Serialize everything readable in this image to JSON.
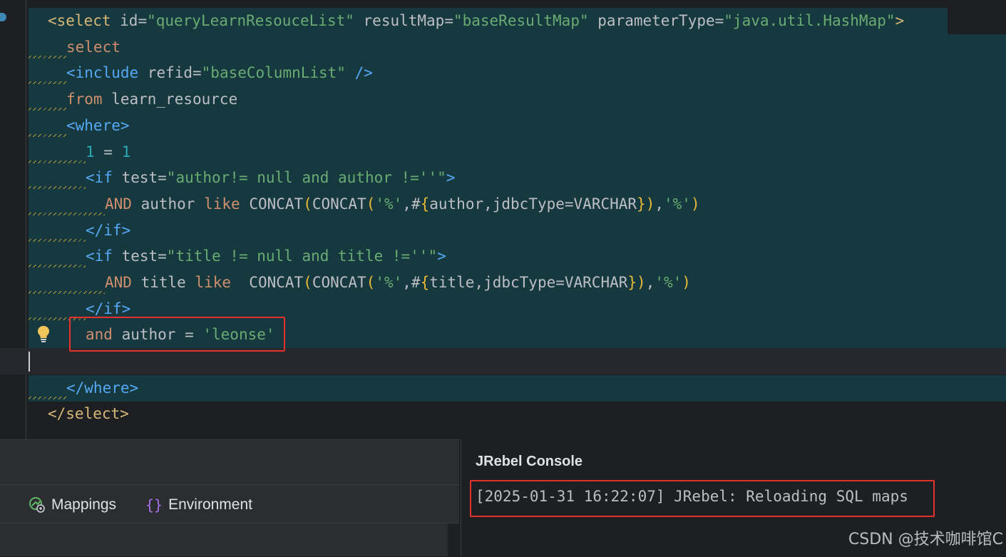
{
  "editor": {
    "lines": [
      {
        "parts": [
          [
            "tag",
            "<select "
          ],
          [
            "attr",
            "id="
          ],
          [
            "val",
            "\"queryLearnResouceList\""
          ],
          [
            "attr",
            " resultMap="
          ],
          [
            "val",
            "\"baseResultMap\""
          ],
          [
            "attr",
            " parameterType="
          ],
          [
            "val",
            "\"java.util.HashMap\""
          ],
          [
            "tag",
            ">"
          ]
        ]
      },
      {
        "parts": [
          [
            "kw",
            "select"
          ]
        ]
      },
      {
        "parts": [
          [
            "sqltag",
            "<include "
          ],
          [
            "attr",
            "refid="
          ],
          [
            "val",
            "\"baseColumnList\""
          ],
          [
            "sqltag",
            " />"
          ]
        ]
      },
      {
        "parts": [
          [
            "kw",
            "from "
          ],
          [
            "attr",
            "learn_resource"
          ]
        ]
      },
      {
        "parts": [
          [
            "sqltag",
            "<where>"
          ]
        ]
      },
      {
        "parts": [
          [
            "num",
            "1"
          ],
          [
            "attr",
            " = "
          ],
          [
            "num",
            "1"
          ]
        ]
      },
      {
        "parts": [
          [
            "sqltag",
            "<if "
          ],
          [
            "attr",
            "test="
          ],
          [
            "val",
            "\"author!= null and author !=''\""
          ],
          [
            "sqltag",
            ">"
          ]
        ]
      },
      {
        "parts": [
          [
            "kw",
            "AND "
          ],
          [
            "attr",
            "author "
          ],
          [
            "kw",
            "like "
          ],
          [
            "fn",
            "CONCAT"
          ],
          [
            "par",
            "("
          ],
          [
            "fn",
            "CONCAT"
          ],
          [
            "par",
            "("
          ],
          [
            "str",
            "'%'"
          ],
          [
            "attr",
            ","
          ],
          [
            "fn",
            "#"
          ],
          [
            "par",
            "{"
          ],
          [
            "attr",
            "author,jdbcType=VARCHAR"
          ],
          [
            "par",
            "}"
          ],
          [
            "par",
            ")"
          ],
          [
            "attr",
            ","
          ],
          [
            "str",
            "'%'"
          ],
          [
            "par",
            ")"
          ]
        ]
      },
      {
        "parts": [
          [
            "sqltag",
            "</if>"
          ]
        ]
      },
      {
        "parts": [
          [
            "sqltag",
            "<if "
          ],
          [
            "attr",
            "test="
          ],
          [
            "val",
            "\"title != null and title !=''\""
          ],
          [
            "sqltag",
            ">"
          ]
        ]
      },
      {
        "parts": [
          [
            "kw",
            "AND "
          ],
          [
            "attr",
            "title "
          ],
          [
            "kw",
            "like  "
          ],
          [
            "fn",
            "CONCAT"
          ],
          [
            "par",
            "("
          ],
          [
            "fn",
            "CONCAT"
          ],
          [
            "par",
            "("
          ],
          [
            "str",
            "'%'"
          ],
          [
            "attr",
            ","
          ],
          [
            "fn",
            "#"
          ],
          [
            "par",
            "{"
          ],
          [
            "attr",
            "title,jdbcType=VARCHAR"
          ],
          [
            "par",
            "}"
          ],
          [
            "par",
            ")"
          ],
          [
            "attr",
            ","
          ],
          [
            "str",
            "'%'"
          ],
          [
            "par",
            ")"
          ]
        ]
      },
      {
        "parts": [
          [
            "sqltag",
            "</if>"
          ]
        ]
      },
      {
        "parts": [
          [
            "kw",
            "and "
          ],
          [
            "attr",
            "author = "
          ],
          [
            "str",
            "'leonse'"
          ]
        ]
      },
      {
        "parts": []
      },
      {
        "parts": [
          [
            "sqltag",
            "</where>"
          ]
        ]
      },
      {
        "parts": [
          [
            "tag",
            "</select>"
          ]
        ]
      }
    ]
  },
  "bottom": {
    "tabs": {
      "mappings": "Mappings",
      "environment": "Environment"
    },
    "console": {
      "title": "JRebel Console",
      "log_line": "[2025-01-31 16:22:07] JRebel: Reloading SQL maps"
    }
  },
  "watermark": "CSDN @技术咖啡馆C",
  "colors": {
    "editor_bg": "#1e1f22",
    "highlight_bg": "#15393f",
    "annotation_red": "#e5312d"
  }
}
